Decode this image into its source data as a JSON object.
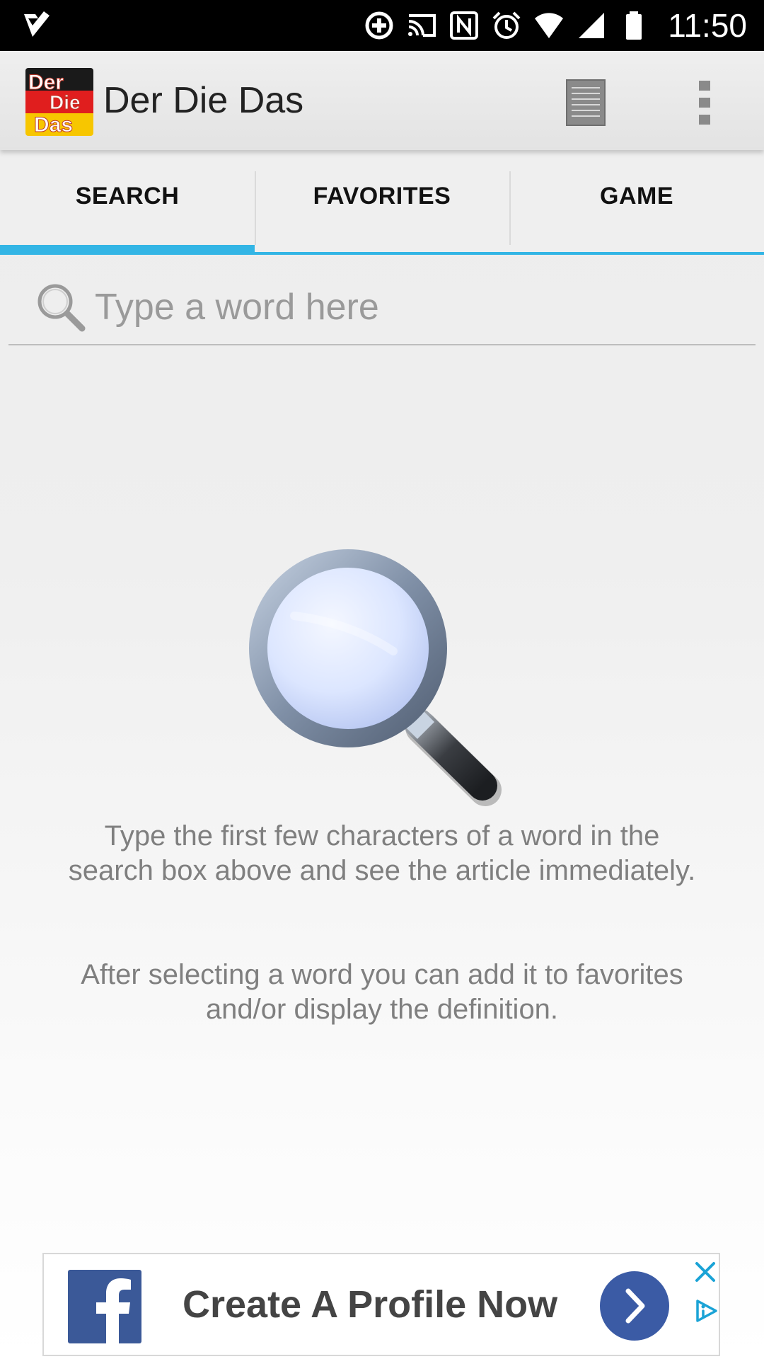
{
  "status_bar": {
    "time": "11:50"
  },
  "app_bar": {
    "title": "Der Die Das",
    "logo_words": [
      "Der",
      "Die",
      "Das"
    ]
  },
  "tabs": [
    {
      "label": "SEARCH",
      "active": true
    },
    {
      "label": "FAVORITES",
      "active": false
    },
    {
      "label": "GAME",
      "active": false
    }
  ],
  "search": {
    "placeholder": "Type a word here",
    "value": ""
  },
  "empty_state": {
    "paragraph1": "Type the first few characters of a word in the search box above and see the article immediately.",
    "paragraph2": "After selecting a word you can add it to favorites and/or display the definition."
  },
  "ad": {
    "text": "Create A Profile Now"
  },
  "colors": {
    "accent": "#33b5e5",
    "facebook": "#3b5998",
    "ad_button": "#3b5ba5"
  }
}
